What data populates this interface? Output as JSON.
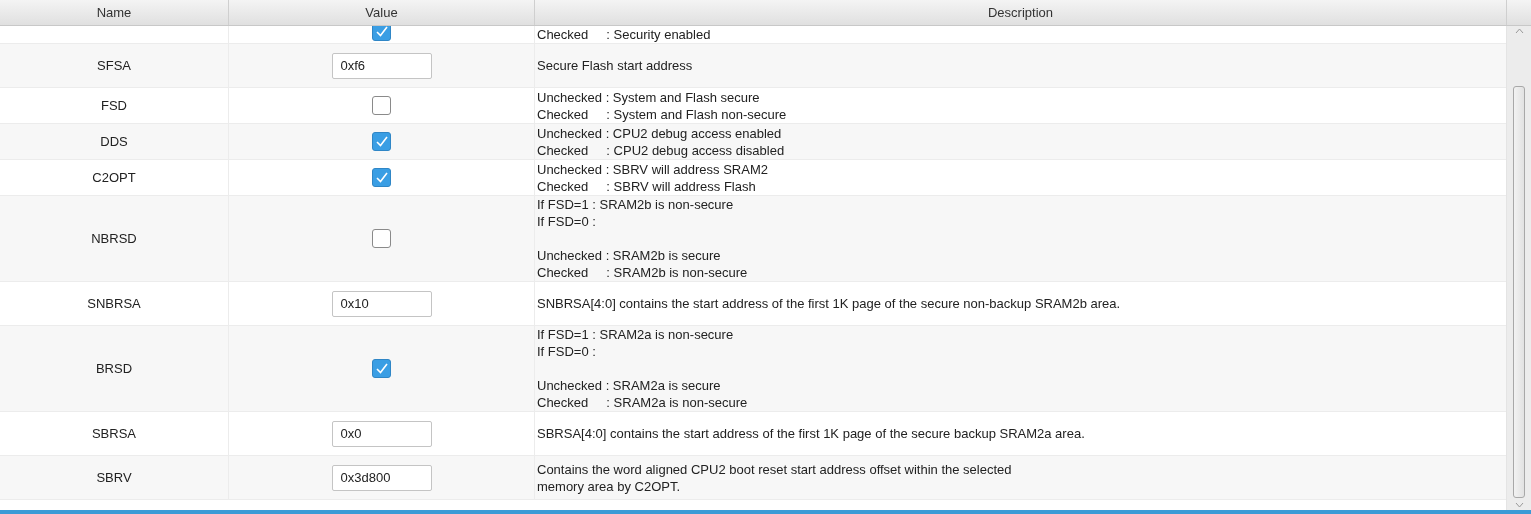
{
  "table": {
    "columns": [
      "Name",
      "Value",
      "Description"
    ],
    "rows": [
      {
        "value": {
          "kind": "checkbox",
          "checked": true
        },
        "description": [
          [
            "Checked     : Security enabled"
          ]
        ]
      },
      {
        "name": "SFSA",
        "value": {
          "kind": "field",
          "text": "0xf6"
        },
        "description": [
          [
            "Secure Flash start address"
          ]
        ]
      },
      {
        "name": "FSD",
        "value": {
          "kind": "checkbox",
          "checked": false
        },
        "description": [
          [
            "Unchecked : System and Flash secure",
            "Checked     : System and Flash non-secure"
          ]
        ]
      },
      {
        "name": "DDS",
        "value": {
          "kind": "checkbox",
          "checked": true
        },
        "description": [
          [
            "Unchecked : CPU2 debug access enabled",
            "Checked     : CPU2 debug access disabled"
          ]
        ]
      },
      {
        "name": "C2OPT",
        "value": {
          "kind": "checkbox",
          "checked": true
        },
        "description": [
          [
            "Unchecked : SBRV will address SRAM2",
            "Checked     : SBRV will address Flash"
          ]
        ]
      },
      {
        "name": "NBRSD",
        "value": {
          "kind": "checkbox",
          "checked": false
        },
        "description": [
          [
            "If FSD=1 : SRAM2b is non-secure",
            "If FSD=0 :"
          ],
          [
            "Unchecked : SRAM2b is secure",
            "Checked     : SRAM2b is non-secure"
          ]
        ]
      },
      {
        "name": "SNBRSA",
        "value": {
          "kind": "field",
          "text": "0x10"
        },
        "description": [
          [
            "SNBRSA[4:0] contains the start address of the first 1K page of the secure non-backup SRAM2b area."
          ]
        ]
      },
      {
        "name": "BRSD",
        "value": {
          "kind": "checkbox",
          "checked": true
        },
        "description": [
          [
            "If FSD=1 : SRAM2a is non-secure",
            "If FSD=0 :"
          ],
          [
            "Unchecked : SRAM2a is secure",
            "Checked     : SRAM2a is non-secure"
          ]
        ]
      },
      {
        "name": "SBRSA",
        "value": {
          "kind": "field",
          "text": "0x0"
        },
        "description": [
          [
            "SBRSA[4:0] contains the start address of the first 1K page of the secure backup SRAM2a area."
          ]
        ]
      },
      {
        "name": "SBRV",
        "value": {
          "kind": "field",
          "text": "0x3d800"
        },
        "description": [
          [
            "Contains the word aligned CPU2 boot reset start address offset within the selected",
            "memory area by C2OPT."
          ]
        ]
      }
    ]
  }
}
